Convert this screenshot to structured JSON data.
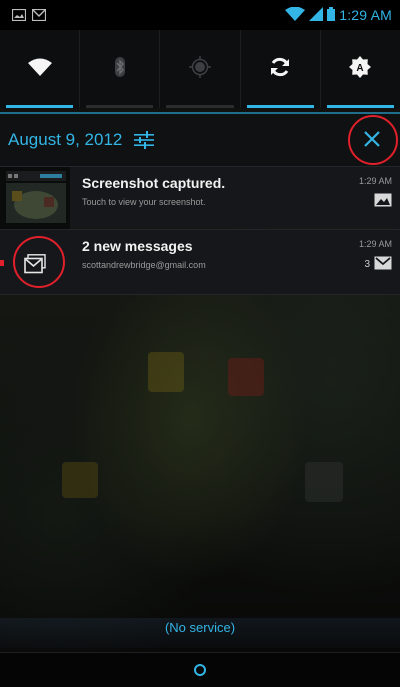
{
  "status_bar": {
    "time": "1:29 AM",
    "left_icons": [
      "screenshot-icon",
      "gmail-icon"
    ],
    "right_icons": [
      "wifi-icon",
      "signal-icon",
      "battery-icon"
    ]
  },
  "quick_settings": {
    "tiles": [
      {
        "name": "wifi",
        "icon": "wifi-icon",
        "active": true
      },
      {
        "name": "bluetooth",
        "icon": "bluetooth-icon",
        "active": false
      },
      {
        "name": "gps",
        "icon": "gps-icon",
        "active": false
      },
      {
        "name": "sync",
        "icon": "sync-icon",
        "active": true
      },
      {
        "name": "auto-brightness",
        "icon": "brightness-auto-icon",
        "active": true
      }
    ]
  },
  "header": {
    "date": "August 9, 2012",
    "settings_icon": "sliders-icon",
    "clear_icon": "close-icon"
  },
  "notifications": [
    {
      "title": "Screenshot captured.",
      "subtitle": "Touch to view your screenshot.",
      "time": "1:29 AM",
      "icon": "image-icon"
    },
    {
      "title": "2 new messages",
      "subtitle": "scottandrewbridge@gmail.com",
      "time": "1:29 AM",
      "count": "3",
      "icon": "gmail-icon"
    }
  ],
  "footer": {
    "service": "(No service)"
  },
  "colors": {
    "accent": "#33b5e5",
    "highlight": "#e0202a"
  }
}
